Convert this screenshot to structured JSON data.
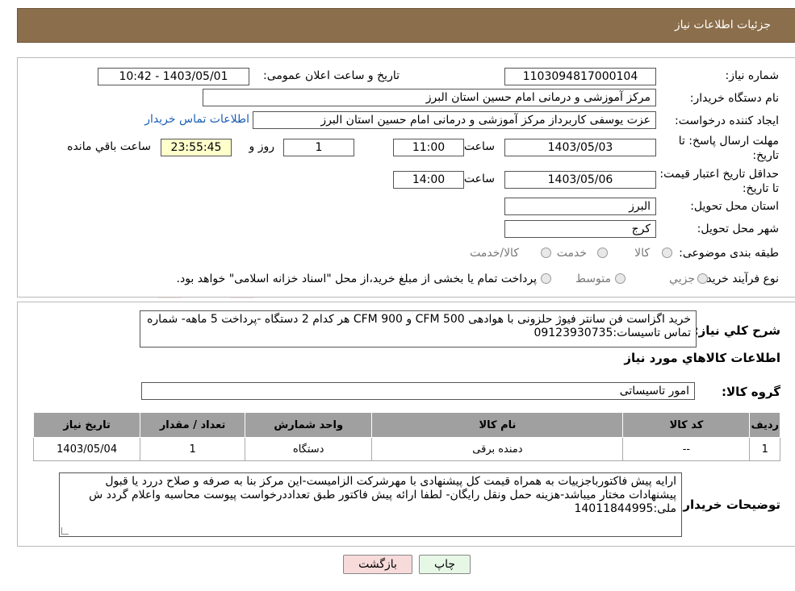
{
  "header": {
    "title": "جزئیات اطلاعات نیاز"
  },
  "form": {
    "need_number_label": "شماره نیاز:",
    "need_number": "1103094817000104",
    "announce_label": "تاریخ و ساعت اعلان عمومی:",
    "announce_value": "1403/05/01 - 10:42",
    "buyer_org_label": "نام دستگاه خریدار:",
    "buyer_org": "مرکز آموزشی و درمانی امام حسین استان البرز",
    "creator_label": "ایجاد کننده درخواست:",
    "creator": "عزت یوسفی کاربرداز مرکز آموزشی و درمانی امام حسین استان البرز",
    "contact_link": "اطلاعات تماس خریدار",
    "deadline_label": "مهلت ارسال پاسخ: تا تاریخ:",
    "deadline_date": "1403/05/03",
    "time_label": "ساعت",
    "deadline_time": "11:00",
    "days_value": "1",
    "days_label": "روز و",
    "remaining_time": "23:55:45",
    "remaining_label": "ساعت باقي مانده",
    "validity_label": "حداقل تاریخ اعتبار قیمت: تا تاریخ:",
    "validity_date": "1403/05/06",
    "validity_time": "14:00",
    "province_label": "استان محل تحویل:",
    "province": "البرز",
    "city_label": "شهر محل تحویل:",
    "city": "کرج",
    "category_label": "طبقه بندی موضوعی:",
    "category_opt1": "کالا",
    "category_opt2": "خدمت",
    "category_opt3": "کالا/خدمت",
    "process_label": "نوع فرآیند خرید :",
    "process_opt1": "جزیي",
    "process_opt2": "متوسط",
    "process_note": "پرداخت تمام یا بخشی از مبلغ خرید،از محل \"اسناد خزانه اسلامی\" خواهد بود."
  },
  "details": {
    "summary_label": "شرح کلي نياز:",
    "summary_text": "خرید اگزاست فن سانتر فیوژ حلزونی با هوادهی 500 CFM و 900 CFM هر کدام 2 دستگاه -پرداخت 5 ماهه- شماره تماس تاسیسات:09123930735",
    "items_heading": "اطلاعات کالاهاي مورد نياز",
    "group_label": "گروه کالا:",
    "group_value": "امور تاسیساتی",
    "table_headers": [
      "رديف",
      "کد کالا",
      "نام کالا",
      "واحد شمارش",
      "تعداد / مقدار",
      "تاریخ نیاز"
    ],
    "table_rows": [
      {
        "row": "1",
        "code": "--",
        "name": "دمنده برقی",
        "unit": "دستگاه",
        "qty": "1",
        "date": "1403/05/04"
      }
    ],
    "buyer_notes_label": "توضیحات خریدار:",
    "buyer_notes": "ارایه پیش فاکتورباجزییات به همراه قیمت کل پیشنهادی با مهرشرکت الزامیست-این مرکز بنا به صرفه و صلاح دررد یا قبول پیشنهادات مختار میباشد-هزینه حمل ونقل رایگان- لطفا ارائه پیش فاکتور طبق تعداددرخواست پیوست محاسبه واعلام گردد ش ملی:14011844995"
  },
  "buttons": {
    "print": "چاپ",
    "back": "بازگشت"
  },
  "colors": {
    "header_bg": "#8b6e4b",
    "table_header_bg": "#a0a0a0",
    "back_btn_bg": "#f7dada",
    "print_btn_bg": "#e6f7e6"
  }
}
